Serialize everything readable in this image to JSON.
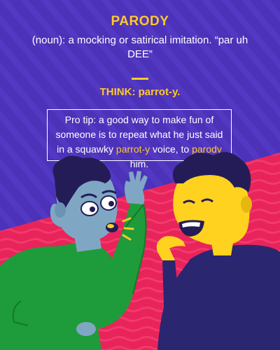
{
  "heading": "PARODY",
  "definition": "(noun): a mocking or satirical imitation. “par uh DEE”",
  "think": "THINK: parrot-y.",
  "tip": {
    "before": "Pro tip: a good way to make fun of someone is to repeat what he just said in a squawky ",
    "highlight1": "parrot-y",
    "middle": " voice, to ",
    "highlight2": "parody",
    "after": " him."
  },
  "colors": {
    "background": "#4b32b8",
    "accent": "#ffc928",
    "floor": "#e8245a",
    "left_person_skin": "#7fa7c4",
    "left_person_shirt": "#1e9b3a",
    "right_person_skin": "#ffd21f",
    "right_person_shirt": "#2b2670"
  }
}
